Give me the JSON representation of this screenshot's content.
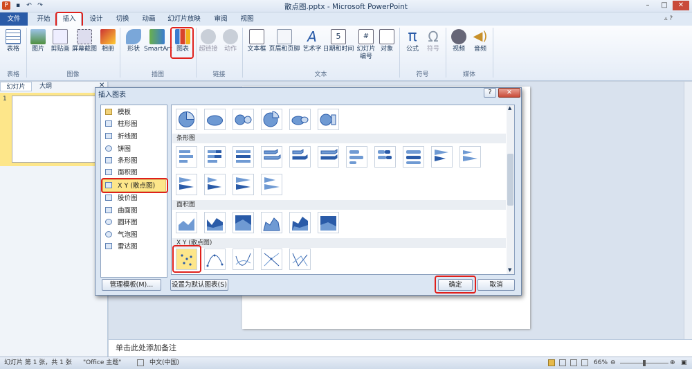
{
  "window": {
    "title": "散点图.pptx - Microsoft PowerPoint"
  },
  "tabs": [
    "开始",
    "插入",
    "设计",
    "切换",
    "动画",
    "幻灯片放映",
    "审阅",
    "视图"
  ],
  "file_tab": "文件",
  "ribbon": {
    "buttons": [
      "表格",
      "图片",
      "剪贴画",
      "屏幕截图",
      "相册",
      "形状",
      "SmartArt",
      "图表",
      "超链接",
      "动作",
      "文本框",
      "页眉和页脚",
      "艺术字",
      "日期和时间",
      "幻灯片\n编号",
      "对象",
      "公式",
      "符号",
      "视频",
      "音频"
    ],
    "groups": [
      "表格",
      "图像",
      "插图",
      "链接",
      "文本",
      "符号",
      "媒体"
    ]
  },
  "pane_tabs": [
    "幻灯片",
    "大纲"
  ],
  "slide_number": "1",
  "notes_placeholder": "单击此处添加备注",
  "dialog": {
    "title": "插入图表",
    "categories": [
      "模板",
      "柱形图",
      "折线图",
      "饼图",
      "条形图",
      "面积图",
      "X Y (散点图)",
      "股价图",
      "曲面图",
      "圆环图",
      "气泡图",
      "雷达图"
    ],
    "sections": [
      "条形图",
      "面积图",
      "X Y (散点图)"
    ],
    "manage_templates": "管理模板(M)...",
    "set_default": "设置为默认图表(S)",
    "ok": "确定",
    "cancel": "取消",
    "help": "?"
  },
  "status": {
    "slide_info": "幻灯片 第 1 张，共 1 张",
    "theme": "\"Office 主题\"",
    "language": "中文(中国)",
    "zoom": "66%"
  },
  "colors": {
    "accent": "#2a5ba8",
    "highlight": "#e0201b",
    "selection": "#fde68a"
  }
}
